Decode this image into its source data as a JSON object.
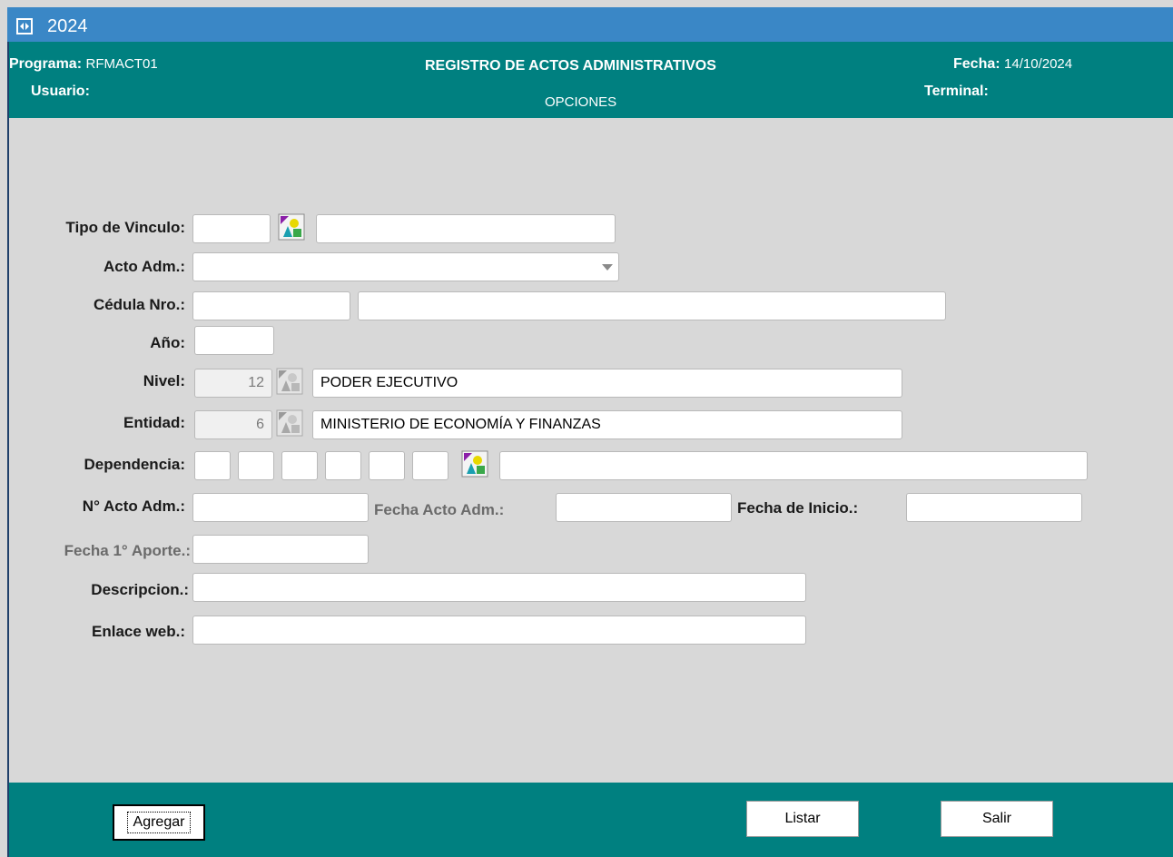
{
  "window": {
    "title": "2024",
    "icon": "app-icon"
  },
  "header": {
    "programa_label": "Programa:",
    "programa_value": "RFMACT01",
    "usuario_label": "Usuario:",
    "title": "REGISTRO DE ACTOS ADMINISTRATIVOS",
    "subtitle": "OPCIONES",
    "fecha_label": "Fecha:",
    "fecha_value": "14/10/2024",
    "terminal_label": "Terminal:"
  },
  "form": {
    "tipo_vinculo": {
      "label": "Tipo de Vinculo:",
      "code": "",
      "desc": ""
    },
    "acto_adm": {
      "label": "Acto Adm.:",
      "value": ""
    },
    "cedula": {
      "label": "Cédula Nro.:",
      "number": "",
      "name": ""
    },
    "anio": {
      "label": "Año:",
      "value": ""
    },
    "nivel": {
      "label": "Nivel:",
      "code": "12",
      "desc": "PODER EJECUTIVO"
    },
    "entidad": {
      "label": "Entidad:",
      "code": "6",
      "desc": "MINISTERIO DE ECONOMÍA Y FINANZAS"
    },
    "dependencia": {
      "label": "Dependencia:",
      "desc": ""
    },
    "nro_acto": {
      "label": "N° Acto Adm.:",
      "value": ""
    },
    "fecha_acto": {
      "label": "Fecha Acto Adm.:",
      "value": ""
    },
    "fecha_inicio": {
      "label": "Fecha de Inicio.:",
      "value": ""
    },
    "fecha_aporte": {
      "label": "Fecha 1° Aporte.:",
      "value": ""
    },
    "descripcion": {
      "label": "Descripcion.:",
      "value": ""
    },
    "enlace_web": {
      "label": "Enlace web.:",
      "value": ""
    }
  },
  "buttons": {
    "agregar": "Agregar",
    "listar": "Listar",
    "salir": "Salir"
  },
  "icons": {
    "lov": "list-of-values-icon",
    "dropdown": "chevron-down-icon"
  },
  "colors": {
    "titlebar": "#3a87c6",
    "header": "#008080",
    "background": "#d8d8d8"
  }
}
